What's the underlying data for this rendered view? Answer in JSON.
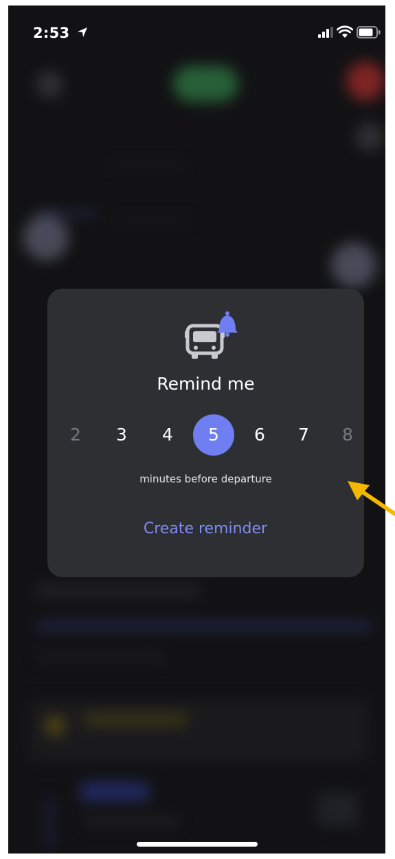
{
  "status_bar": {
    "time": "2:53",
    "icons": [
      "location-arrow-icon",
      "cellular-signal-icon",
      "wifi-icon",
      "battery-icon"
    ]
  },
  "reminder_card": {
    "icon": "bus-bell-icon",
    "title": "Remind me",
    "minute_options": [
      {
        "label": "2",
        "state": "dim"
      },
      {
        "label": "3",
        "state": "normal"
      },
      {
        "label": "4",
        "state": "normal"
      },
      {
        "label": "5",
        "state": "selected"
      },
      {
        "label": "6",
        "state": "normal"
      },
      {
        "label": "7",
        "state": "normal"
      },
      {
        "label": "8",
        "state": "dim"
      }
    ],
    "selected_minutes": "5",
    "caption": "minutes before departure",
    "create_button_label": "Create reminder"
  },
  "annotation": {
    "icon": "arrow-icon",
    "color": "#f5b800"
  },
  "colors": {
    "accent": "#6f7ff2",
    "card_background": "#2e2f33",
    "screen_background": "#121214"
  }
}
